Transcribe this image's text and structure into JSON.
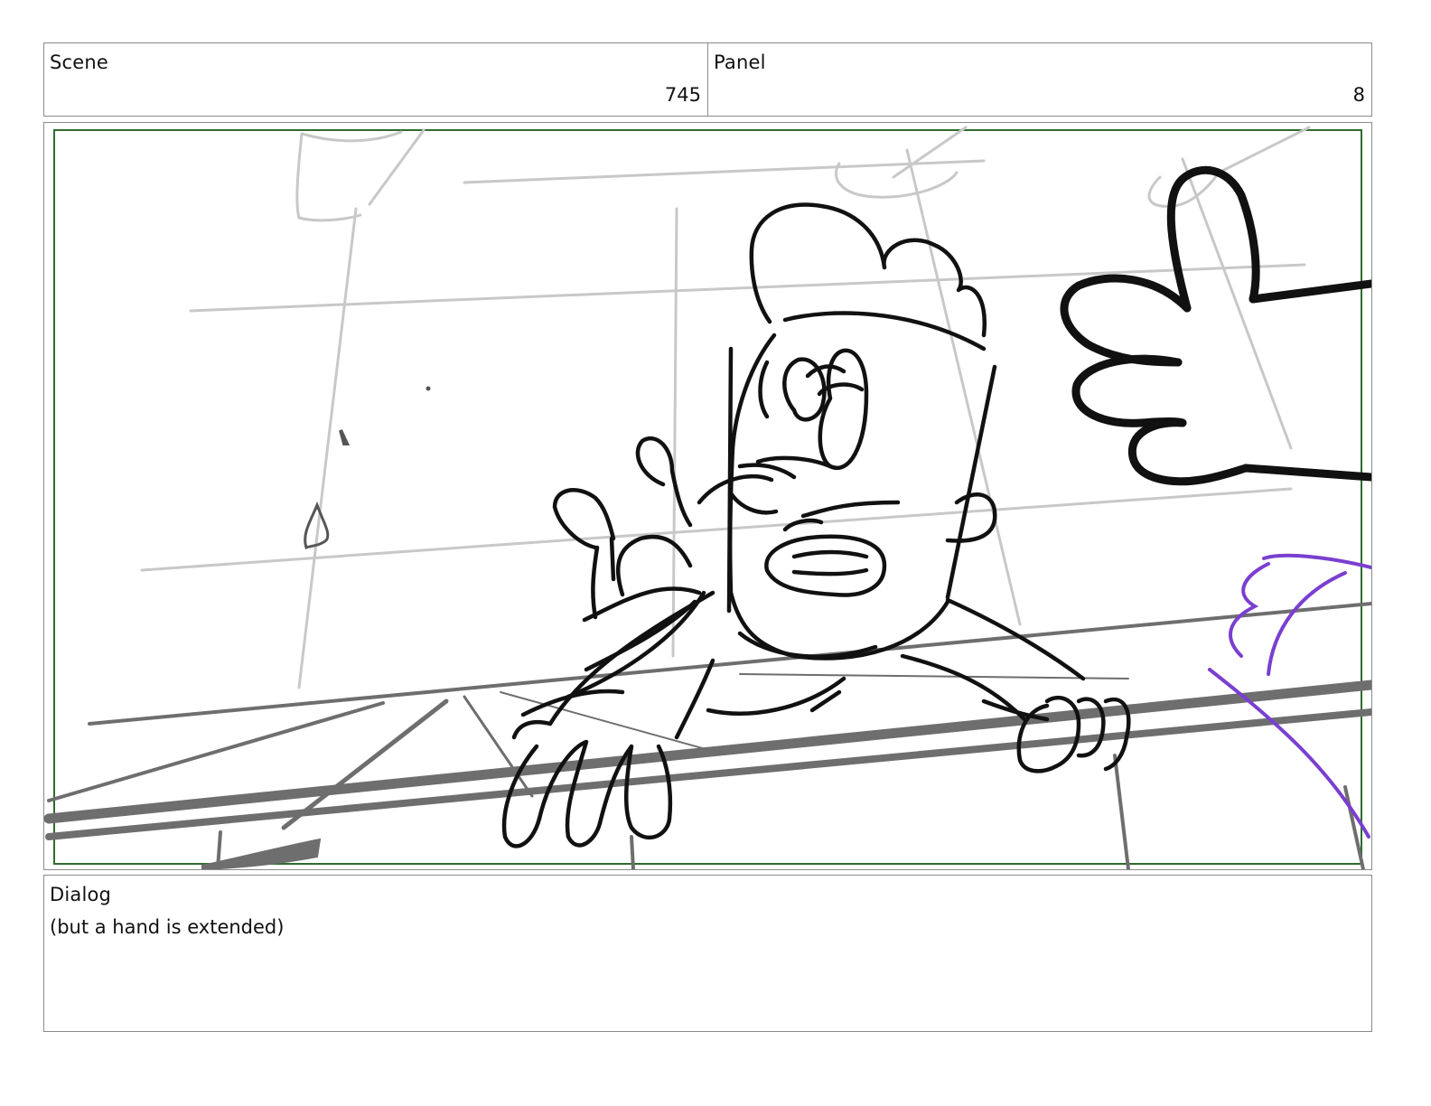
{
  "scene": {
    "label": "Scene",
    "number": "745"
  },
  "panel": {
    "label": "Panel",
    "number": "8"
  },
  "frame": {
    "safe_area_color": "#2e6b2e",
    "ink_color": "#111111",
    "rough_color": "#c8c8c8",
    "prop_color": "#6e6e6e",
    "accent_color": "#7a3fd0"
  },
  "dialog": {
    "label": "Dialog",
    "text": "(but a hand is extended)"
  }
}
